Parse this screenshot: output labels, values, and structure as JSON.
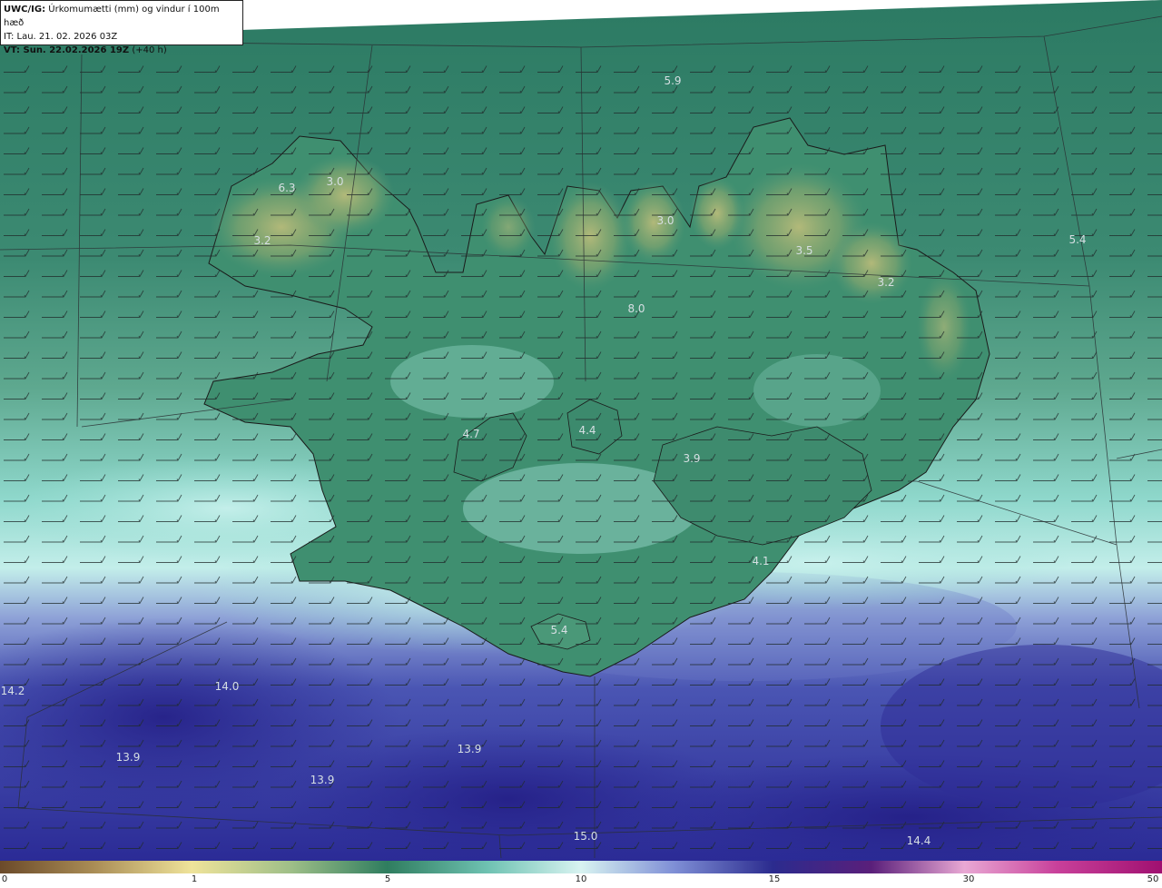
{
  "header": {
    "code": "UWC/IG:",
    "title": "Úrkomumætti (mm) og vindur í 100m hæð",
    "init_time": "IT: Lau. 21. 02. 2026 03Z",
    "valid_time": "VT: Sun. 22.02.2026 19Z",
    "lead_time": "(+40 h)"
  },
  "map_labels": [
    {
      "id": "westfjords-1",
      "text": "6.3"
    },
    {
      "id": "westfjords-2",
      "text": "3.0"
    },
    {
      "id": "westfjords-3",
      "text": "3.2"
    },
    {
      "id": "north-sea",
      "text": "5.9"
    },
    {
      "id": "trollaskagi",
      "text": "3.0"
    },
    {
      "id": "northeast",
      "text": "3.5"
    },
    {
      "id": "east-sea",
      "text": "5.4"
    },
    {
      "id": "eastfjords",
      "text": "3.2"
    },
    {
      "id": "north-interior",
      "text": "8.0"
    },
    {
      "id": "langjokull",
      "text": "4.7"
    },
    {
      "id": "hofsjokull",
      "text": "4.4"
    },
    {
      "id": "vatnajokull",
      "text": "3.9"
    },
    {
      "id": "oraefi",
      "text": "4.1"
    },
    {
      "id": "myrdalsjokull",
      "text": "5.4"
    },
    {
      "id": "sw-sea-edge",
      "text": "14.2"
    },
    {
      "id": "sw-sea",
      "text": "14.0"
    },
    {
      "id": "s-sea-1",
      "text": "13.9"
    },
    {
      "id": "s-sea-2",
      "text": "13.9"
    },
    {
      "id": "s-sea-3",
      "text": "13.9"
    },
    {
      "id": "s-sea-4",
      "text": "15.0"
    },
    {
      "id": "se-sea",
      "text": "14.4"
    }
  ],
  "colorbar": {
    "ticks": [
      "0",
      "1",
      "5",
      "10",
      "15",
      "30",
      "50"
    ]
  },
  "colors": {
    "land_low": "#3f8f70",
    "land_high": "#a7b578",
    "sea_north": "#2f7d66",
    "mid": "#7fd3c6",
    "pale": "#c9efeb",
    "sea_south": "#3a43a6",
    "deep": "#24208a",
    "coast": "#1a1a1a",
    "barb": "#1f2a2a"
  }
}
